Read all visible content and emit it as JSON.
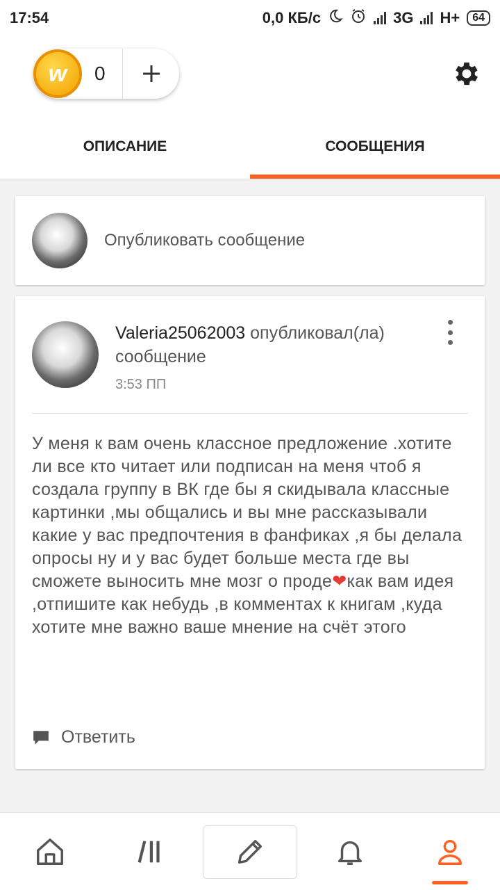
{
  "status_bar": {
    "time": "17:54",
    "network_speed": "0,0 КБ/с",
    "network_1": "3G",
    "network_2": "H+",
    "battery": "64"
  },
  "header": {
    "coin_count": "0",
    "coin_letter": "w",
    "add_label": "+"
  },
  "tabs": [
    {
      "label": "ОПИСАНИЕ",
      "active": false
    },
    {
      "label": "СООБЩЕНИЯ",
      "active": true
    }
  ],
  "post_box": {
    "placeholder": "Опубликовать сообщение"
  },
  "message": {
    "username": "Valeria25062003",
    "action": " опубликовал(ла) сообщение",
    "time": "3:53 ПП",
    "body_before_heart": "У меня к вам очень классное предложение .хотите ли все кто читает или подписан на меня чтоб я создала группу в ВК где бы я скидывала классные картинки ,мы общались и вы мне рассказывали какие у вас предпочтения в фанфиках ,я бы делала опросы ну и у вас будет больше места где вы сможете выносить мне мозг о проде",
    "heart": "❤",
    "body_after_heart": "как вам идея ,отпишите как небудь ,в комментах к книгам ,куда хотите мне важно ваше мнение на счёт этого",
    "reply_label": "Ответить"
  },
  "colors": {
    "accent": "#ff6122",
    "coin": "#f2a000"
  },
  "bottom_nav": [
    {
      "icon": "home-icon"
    },
    {
      "icon": "library-icon"
    },
    {
      "icon": "pencil-icon"
    },
    {
      "icon": "bell-icon"
    },
    {
      "icon": "profile-icon",
      "active": true
    }
  ]
}
